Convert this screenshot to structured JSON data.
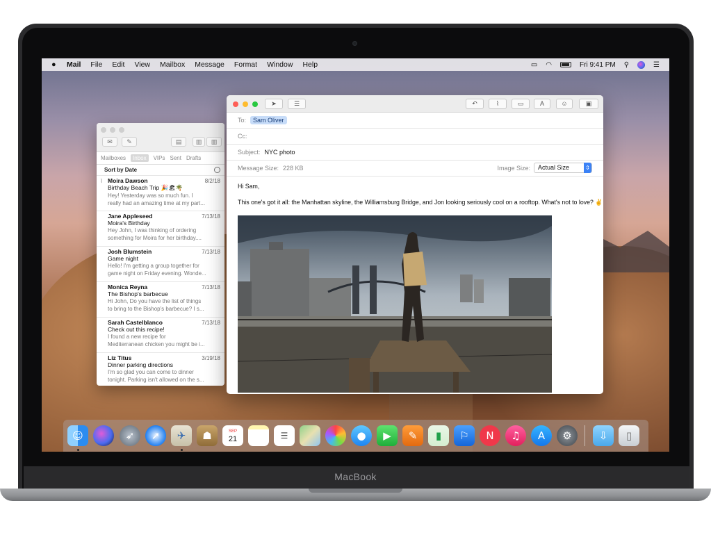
{
  "device": {
    "brand": "MacBook"
  },
  "menubar": {
    "apple": "",
    "items": [
      "Mail",
      "File",
      "Edit",
      "View",
      "Mailbox",
      "Message",
      "Format",
      "Window",
      "Help"
    ],
    "clock": "Fri 9:41 PM",
    "status_icons": [
      "airplay-icon",
      "wifi-icon",
      "battery-icon",
      "search-icon",
      "siri-icon",
      "list-icon"
    ]
  },
  "mailbox_window": {
    "tabs": [
      "Mailboxes",
      "Inbox",
      "VIPs",
      "Sent",
      "Drafts"
    ],
    "selected_tab": "Inbox",
    "sort_label": "Sort by Date",
    "messages": [
      {
        "from": "Moira Dawson",
        "date": "8/2/18",
        "subject": "Birthday Beach Trip 🎉🏖🌴",
        "preview1": "Hey! Yesterday was so much fun. I",
        "preview2": "really had an amazing time at my part..."
      },
      {
        "from": "Jane Appleseed",
        "date": "7/13/18",
        "subject": "Moira's Birthday",
        "preview1": "Hey John, I was thinking of ordering",
        "preview2": "something for Moira for her birthday...."
      },
      {
        "from": "Josh Blumstein",
        "date": "7/13/18",
        "subject": "Game night",
        "preview1": "Hello! I'm getting a group together for",
        "preview2": "game night on Friday evening. Wonde..."
      },
      {
        "from": "Monica Reyna",
        "date": "7/13/18",
        "subject": "The Bishop's barbecue",
        "preview1": "Hi John, Do you have the list of things",
        "preview2": "to bring to the Bishop's barbecue? I s..."
      },
      {
        "from": "Sarah Castelblanco",
        "date": "7/13/18",
        "subject": "Check out this recipe!",
        "preview1": "I found a new recipe for",
        "preview2": "Mediterranean chicken you might be i..."
      },
      {
        "from": "Liz Titus",
        "date": "3/19/18",
        "subject": "Dinner parking directions",
        "preview1": "I'm so glad you can come to dinner",
        "preview2": "tonight. Parking isn't allowed on the s..."
      }
    ]
  },
  "compose": {
    "to_label": "To:",
    "to_value": "Sam Oliver",
    "cc_label": "Cc:",
    "subject_label": "Subject:",
    "subject_value": "NYC photo",
    "size_label": "Message Size:",
    "size_value": "228 KB",
    "image_size_label": "Image Size:",
    "image_size_value": "Actual Size",
    "greeting": "Hi Sam,",
    "body": "This one's got it all: the Manhattan skyline, the Williamsburg Bridge, and Jon looking seriously cool on a rooftop. What's not to love? ✌️",
    "toolbar_labels": {
      "format_label": "A"
    }
  },
  "dock": {
    "apps": [
      "finder",
      "siri",
      "launchpad",
      "safari",
      "mail",
      "contacts",
      "calendar",
      "notes",
      "reminders",
      "maps",
      "photos",
      "messages",
      "facetime",
      "keynote",
      "numbers",
      "pages",
      "news",
      "music",
      "app-store",
      "system-preferences",
      "downloads",
      "trash"
    ],
    "calendar_month": "SEP",
    "calendar_day": "21"
  },
  "colors": {
    "accent": "#3b82f6",
    "chip_bg": "#c7dcf8",
    "close": "#fe5f57",
    "minimize": "#febc2e",
    "zoom": "#28c840"
  }
}
